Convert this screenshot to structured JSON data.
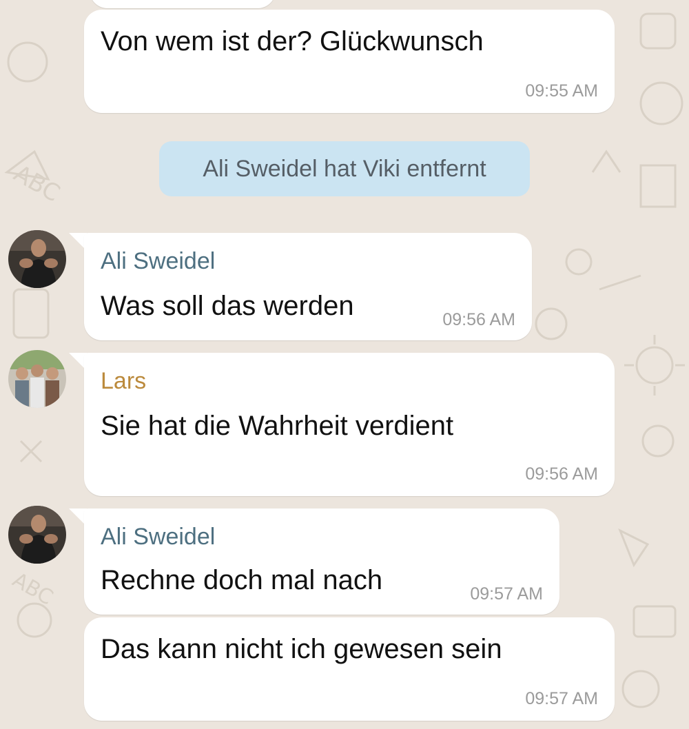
{
  "colors": {
    "background": "#ece5dd",
    "bubble": "#ffffff",
    "system_bubble": "#cbe4f2",
    "sender_ali": "#4d6f80",
    "sender_lars": "#bb8a3c",
    "timestamp": "#9b9b9b"
  },
  "icons": {
    "avatar_ali": "avatar-photo-man-flexing",
    "avatar_lars": "avatar-photo-group-of-friends"
  },
  "messages": {
    "m1": {
      "text": "Von wem ist der? Glückwunsch",
      "time": "09:55 AM"
    },
    "system": {
      "text": "Ali Sweidel hat Viki entfernt"
    },
    "m2": {
      "sender": "Ali Sweidel",
      "text": "Was soll das werden",
      "time": "09:56 AM"
    },
    "m3": {
      "sender": "Lars",
      "text": "Sie hat die Wahrheit verdient",
      "time": "09:56 AM"
    },
    "m4": {
      "sender": "Ali Sweidel",
      "text": "Rechne doch mal nach",
      "time": "09:57 AM"
    },
    "m5": {
      "text": "Das kann nicht ich gewesen sein",
      "time": "09:57 AM"
    }
  }
}
